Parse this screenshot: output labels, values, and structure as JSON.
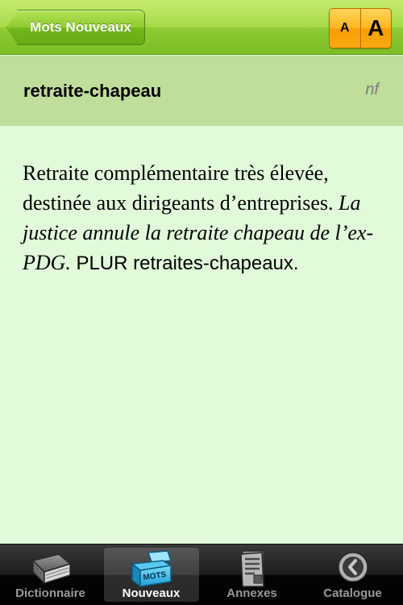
{
  "navbar": {
    "back_label": "Mots Nouveaux",
    "font_small": "A",
    "font_large": "A"
  },
  "entry": {
    "headword": "retraite-chapeau",
    "part_of_speech": "nf",
    "definition": "Retraite complémentaire très élevée, destinée aux dirigeants d’entreprises.",
    "example": "La justice annule la retraite chapeau de l’ex-PDG.",
    "plural": "PLUR retraites-chapeaux."
  },
  "tabbar": {
    "selected": "Nouveaux",
    "tabs": [
      {
        "label": "Dictionnaire",
        "icon": "book-icon"
      },
      {
        "label": "Nouveaux",
        "icon": "new-words-box-icon",
        "icon_text": "MOTS"
      },
      {
        "label": "Annexes",
        "icon": "document-icon"
      },
      {
        "label": "Catalogue",
        "icon": "clock-icon"
      }
    ]
  },
  "colors": {
    "nav_green": "#8fcb34",
    "header_green": "#bfdd9b",
    "background": "#e1fad9",
    "font_button_orange": "#ffb51f",
    "tabbar_selected_icon": "#2fb8ea"
  }
}
